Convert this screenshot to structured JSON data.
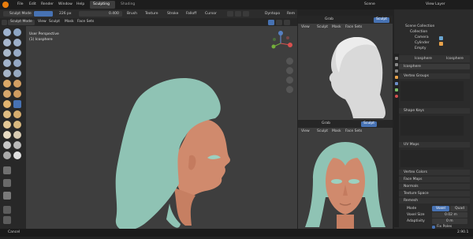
{
  "menu": {
    "items": [
      "File",
      "Edit",
      "Render",
      "Window",
      "Help"
    ],
    "workspace_tabs": [
      "Sculpting",
      "Shading"
    ],
    "active_tab": "Sculpting",
    "scene_label": "Scene",
    "view_layer_label": "View Layer"
  },
  "tool_header": {
    "mode": "Sculpt Mode",
    "brush_menus": [
      "Brush",
      "Texture",
      "Stroke",
      "Falloff",
      "Cursor"
    ],
    "strength_value": "0.400",
    "radius_value": "226 px",
    "symmetry_menus": [
      "Dyntopo",
      "Rem"
    ]
  },
  "viewport_menu": [
    "View",
    "Sculpt",
    "Mask",
    "Face Sets"
  ],
  "viewport": {
    "perspective": "User Perspective",
    "object": "(1) Icosphere"
  },
  "small_view_menu": [
    "View",
    "Sculpt",
    "Mask",
    "Face Sets"
  ],
  "small_view_tool": "Grab",
  "small_view_mode": "Sculpt",
  "outliner": {
    "root": "Scene Collection",
    "items": [
      "Collection",
      "Camera",
      "Cylinder",
      "Empty"
    ]
  },
  "properties": {
    "object_name": "Icosphere",
    "data_name": "Icosphere",
    "panels": [
      "Vertex Groups",
      "Shape Keys",
      "UV Maps",
      "Vertex Colors",
      "Face Maps",
      "Normals",
      "Texture Space",
      "Remesh"
    ],
    "remesh": {
      "mode_label": "Mode",
      "mode_options": [
        "Voxel",
        "Quad"
      ],
      "voxel_size_label": "Voxel Size",
      "voxel_size_value": "0.02 m",
      "adaptivity_label": "Adaptivity",
      "adaptivity_value": "0 m",
      "fix_poles_label": "Fix Poles"
    }
  },
  "status": {
    "left": "Cancel",
    "right": "2.90.1"
  },
  "colors": {
    "hair": "#8fc3b4",
    "skin": "#d08a6d",
    "bust": "#d9d9d9",
    "accent": "#4772b3"
  }
}
